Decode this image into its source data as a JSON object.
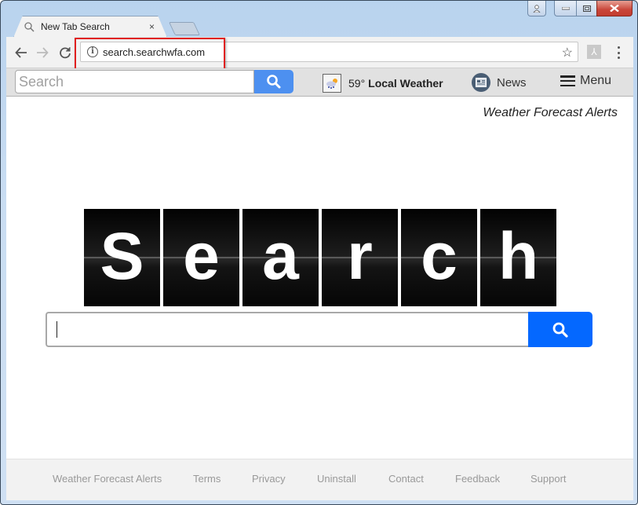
{
  "browser": {
    "tab_title": "New Tab Search",
    "tab_close": "×",
    "url": "search.searchwfa.com",
    "icons": {
      "tab": "search-icon",
      "back": "arrow-left-icon",
      "forward": "arrow-right-icon",
      "reload": "reload-icon",
      "info": "info-icon",
      "bookmark": "star-icon",
      "extension": "pdf-icon",
      "menu": "three-dots-icon"
    },
    "highlight_color": "#e02020"
  },
  "header": {
    "search_placeholder": "Search",
    "weather_temp": "59°",
    "weather_label": "Local Weather",
    "news_label": "News",
    "menu_label": "Menu",
    "accent": "#4d90f0"
  },
  "main": {
    "tagline": "Weather Forecast Alerts",
    "logo_letters": [
      "S",
      "e",
      "a",
      "r",
      "c",
      "h"
    ],
    "search_value": "",
    "search_button_color": "#0468ff"
  },
  "footer": {
    "links": [
      "Weather Forecast Alerts",
      "Terms",
      "Privacy",
      "Uninstall",
      "Contact",
      "Feedback",
      "Support"
    ]
  }
}
